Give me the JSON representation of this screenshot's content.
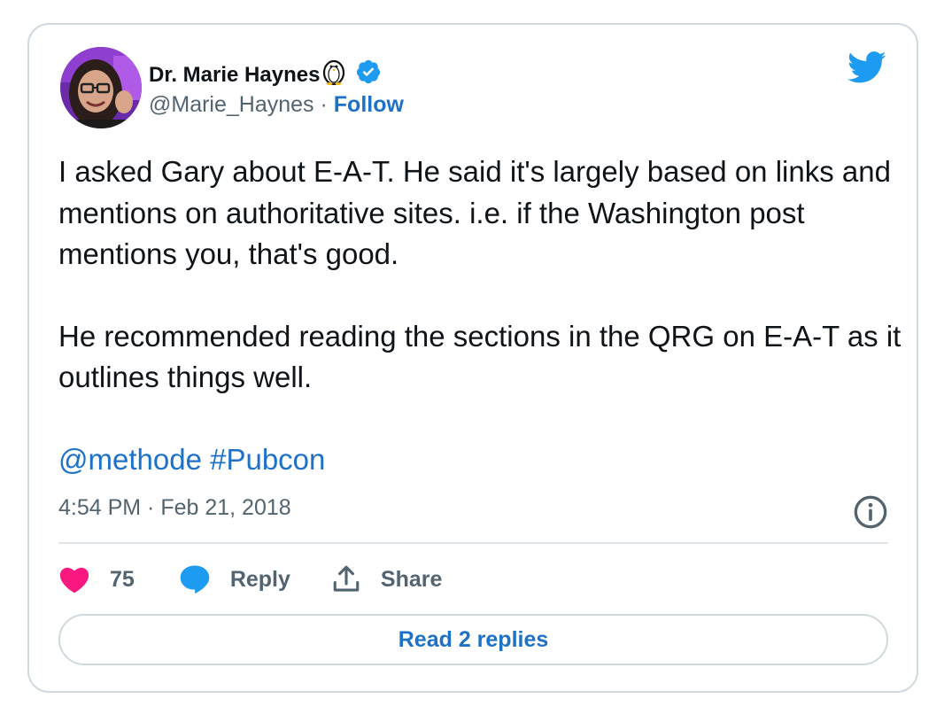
{
  "author": {
    "display_name": "Dr. Marie Haynes",
    "handle": "@Marie_Haynes",
    "separator": " · ",
    "follow_label": "Follow",
    "avatar_icon": "profile-photo",
    "badge_icons": [
      "penguin-icon",
      "verified-badge-icon"
    ]
  },
  "brand": {
    "logo_icon": "twitter-bird-icon",
    "color": "#1d9bf0"
  },
  "tweet": {
    "paragraph_1": "I asked Gary about E-A-T. He said it's largely based on links and mentions on authoritative sites. i.e. if the Washington post mentions you, that's good.",
    "paragraph_2": "He recommended reading the sections in the QRG on E-A-T as it outlines things well.",
    "mention": "@methode",
    "hashtag": "#Pubcon",
    "timestamp": "4:54 PM · Feb 21, 2018"
  },
  "actions": {
    "like_count": "75",
    "reply_label": "Reply",
    "share_label": "Share",
    "read_replies_label": "Read 2 replies"
  },
  "colors": {
    "link": "#1d72c7",
    "like": "#f91880",
    "text": "#0f1419",
    "secondary": "#536471",
    "border": "#cfd9de"
  }
}
